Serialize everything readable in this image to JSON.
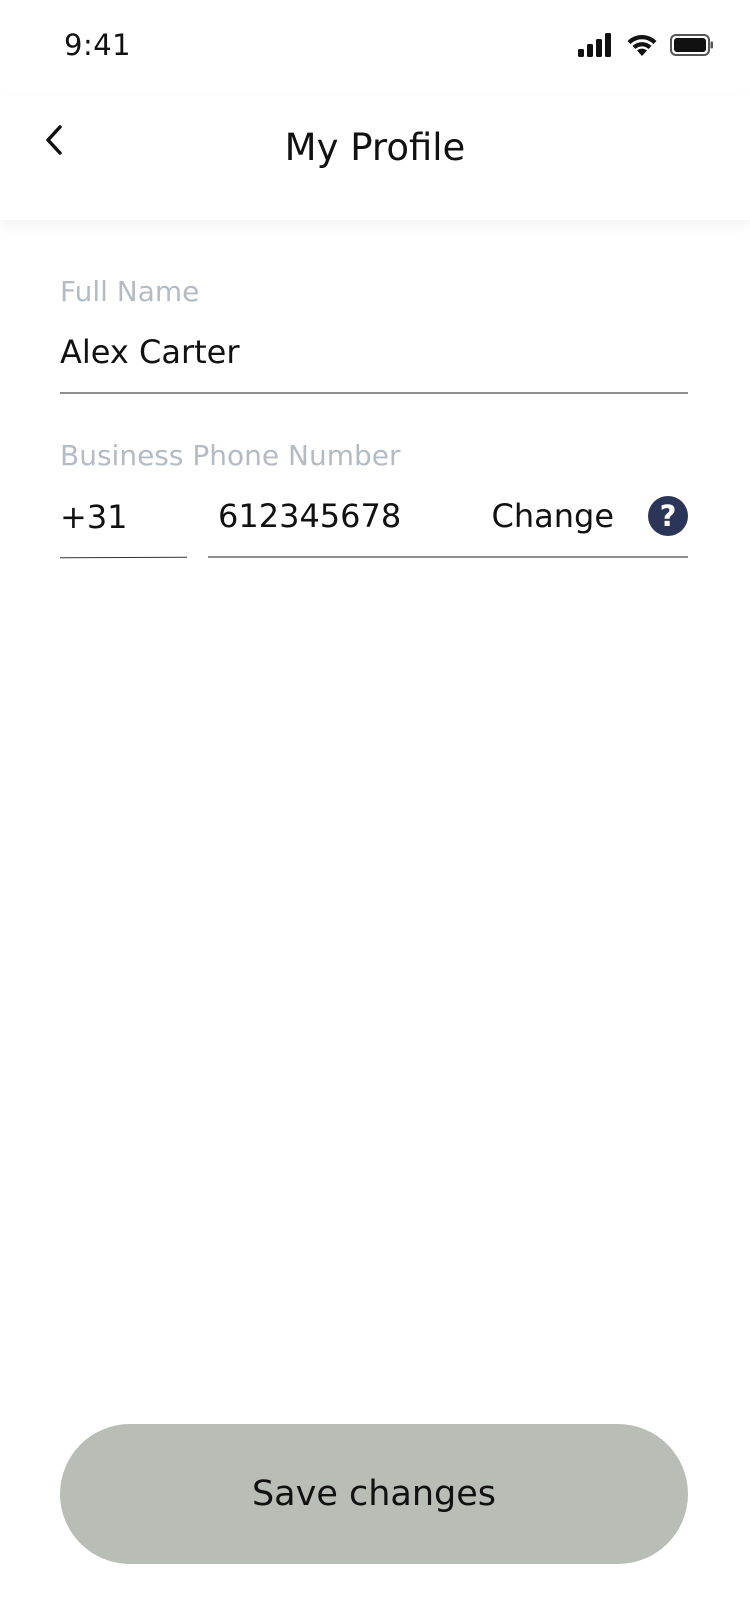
{
  "status_bar": {
    "time": "9:41",
    "icons": [
      "signal-icon",
      "wifi-icon",
      "battery-icon"
    ]
  },
  "header": {
    "title": "My Profile",
    "back_icon": "chevron-left-icon"
  },
  "form": {
    "full_name": {
      "label": "Full Name",
      "value": "Alex Carter"
    },
    "business_phone": {
      "label": "Business Phone Number",
      "country_code": "+31",
      "number": "612345678",
      "change_label": "Change",
      "help_symbol": "?"
    }
  },
  "footer": {
    "save_label": "Save changes"
  },
  "colors": {
    "label": "#b3bcc5",
    "text": "#111111",
    "help_icon_bg": "#2b3557",
    "save_button_bg": "#b8beb5"
  }
}
